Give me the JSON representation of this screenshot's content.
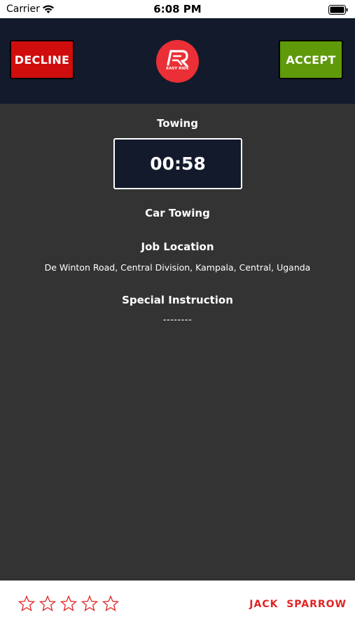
{
  "status_bar": {
    "carrier": "Carrier",
    "time": "6:08 PM"
  },
  "header": {
    "decline_label": "DECLINE",
    "accept_label": "ACCEPT",
    "logo_text": "EASY RIDE",
    "logo_subtext": "",
    "colors": {
      "background": "#121a2c",
      "decline": "#d00d0d",
      "accept": "#5f9a0a",
      "logo": "#ea2f36"
    }
  },
  "request": {
    "service_type": "Towing",
    "timer": "00:58",
    "service_name": "Car Towing",
    "job_location_label": "Job Location",
    "job_location": "De Winton Road, Central Division, Kampala, Central, Uganda",
    "special_instruction_label": "Special Instruction",
    "special_instruction": "--------"
  },
  "footer": {
    "rating": 0,
    "rating_max": 5,
    "driver_name": "JACK  SPARROW",
    "accent_color": "#e02424"
  }
}
